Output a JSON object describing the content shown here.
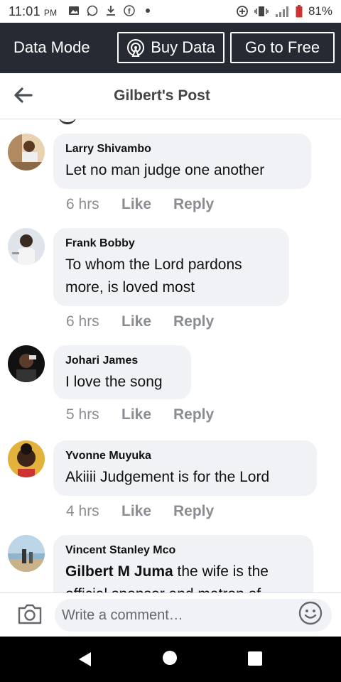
{
  "status_bar": {
    "time": "11:01",
    "ampm": "PM",
    "battery": "81%",
    "left_icons": [
      "gallery-icon",
      "whatsapp-icon",
      "download-icon",
      "facebook-icon",
      "dot-icon"
    ],
    "right_icons": [
      "data-saver-icon",
      "vibrate-icon",
      "signal-icon",
      "battery-icon"
    ]
  },
  "data_bar": {
    "mode_label": "Data Mode",
    "buy_label": "Buy Data",
    "free_label": "Go to Free"
  },
  "header": {
    "title": "Gilbert's Post"
  },
  "comments": [
    {
      "author": "Larry Shivambo",
      "text": "Let no man judge one another",
      "time": "6 hrs",
      "like": "Like",
      "reply": "Reply"
    },
    {
      "author": "Frank Bobby",
      "text_lines": [
        "To whom the Lord  pardons",
        "more, is loved most"
      ],
      "time": "6 hrs",
      "like": "Like",
      "reply": "Reply"
    },
    {
      "author": "Johari James",
      "text": "I love the song",
      "time": "5 hrs",
      "like": "Like",
      "reply": "Reply"
    },
    {
      "author": "Yvonne Muyuka",
      "text": "Akiiii Judgement is for the Lord",
      "time": "4 hrs",
      "like": "Like",
      "reply": "Reply"
    },
    {
      "author": "Vincent Stanley Mco",
      "mention": "Gilbert M Juma",
      "text_after_mention": " the wife is the",
      "text_line2": "official sponsor and matron of"
    }
  ],
  "composer": {
    "placeholder": "Write a comment…"
  },
  "colors": {
    "data_bar_bg": "#262a33",
    "bubble_bg": "#f0f2f5",
    "meta_text": "#8a8d91"
  }
}
